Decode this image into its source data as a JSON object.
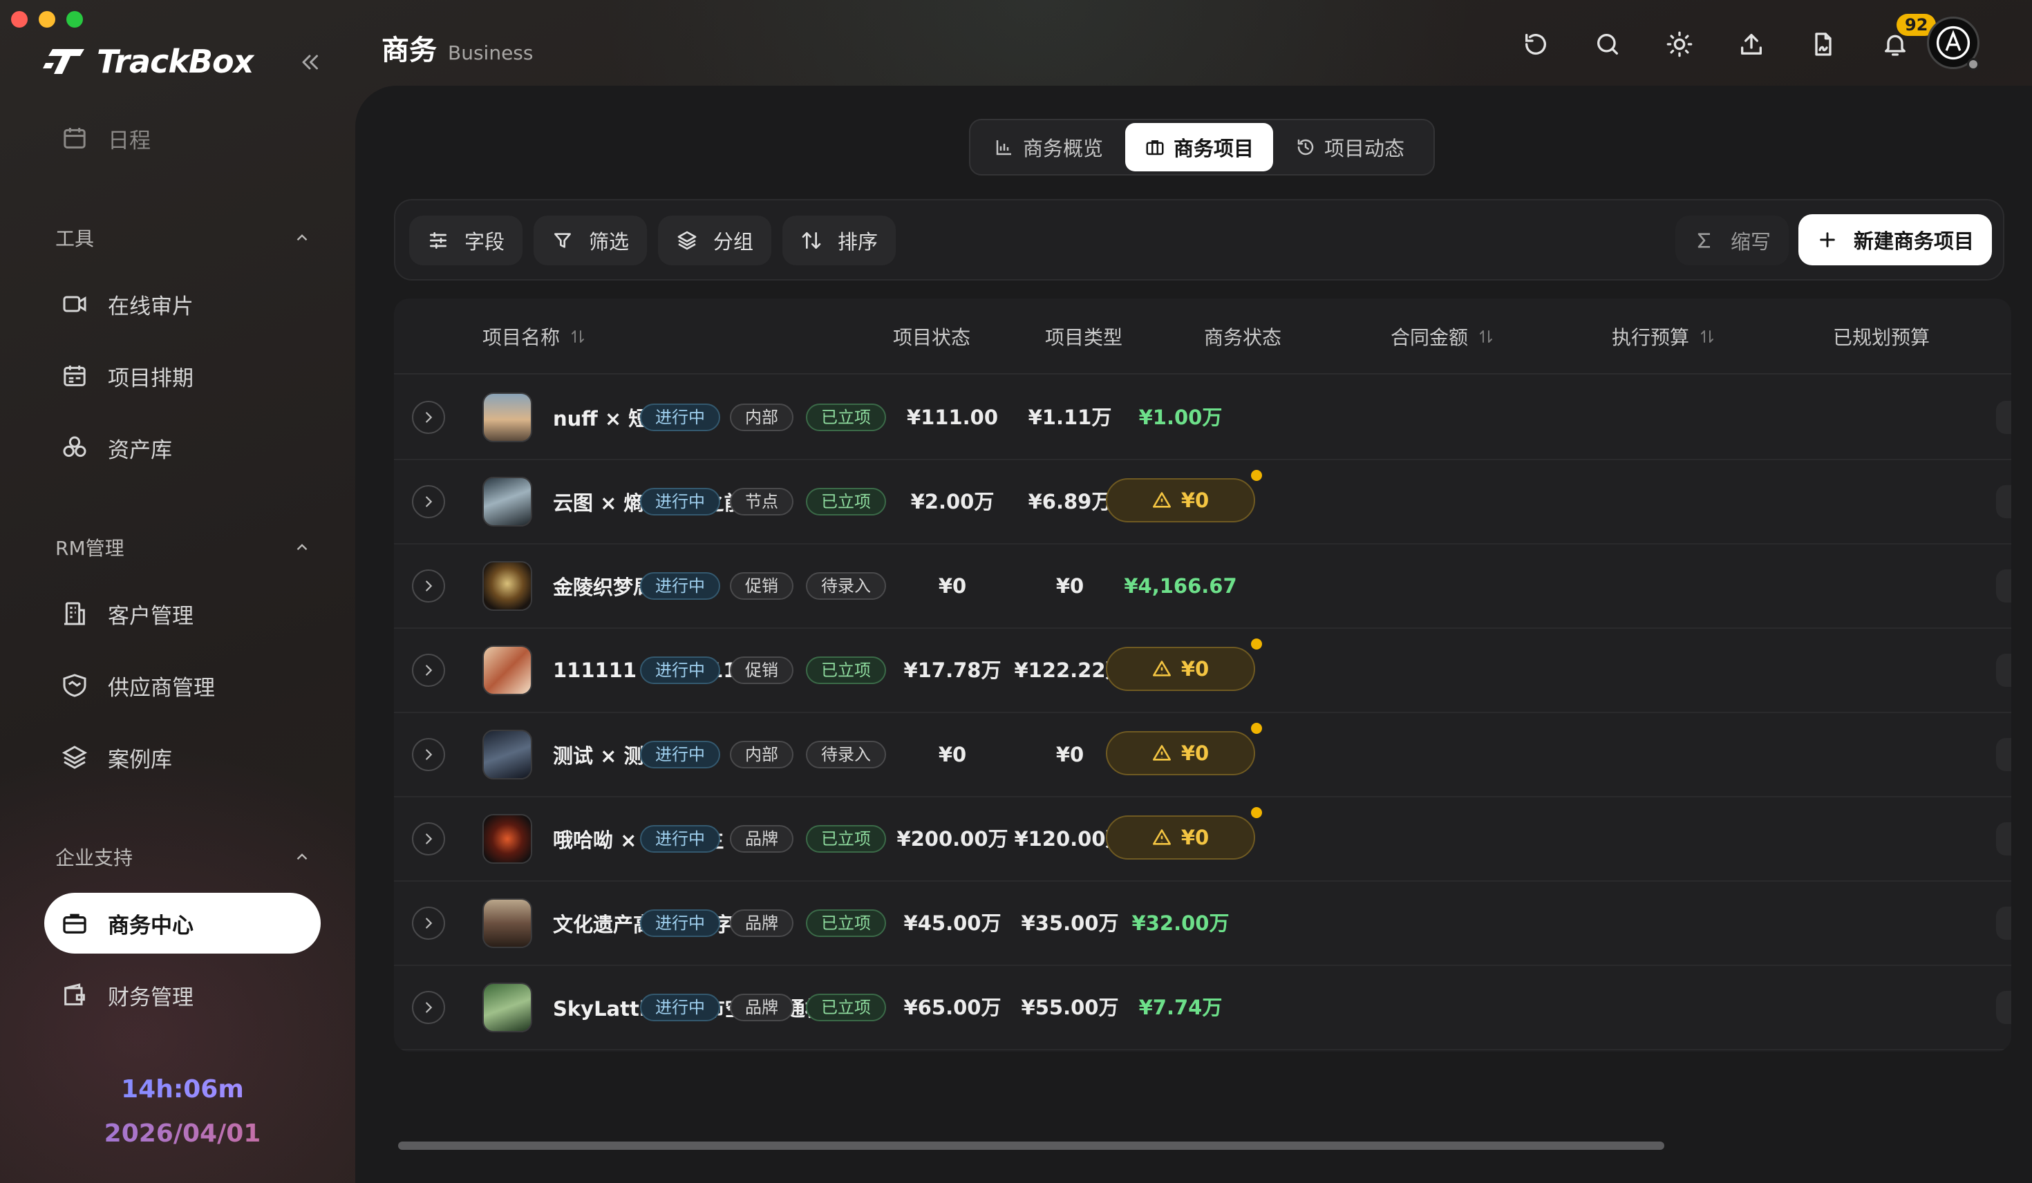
{
  "app": {
    "name": "TrackBox"
  },
  "sidebar": {
    "top_item": {
      "label": "日程",
      "icon": "calendar-icon"
    },
    "sections": [
      {
        "title": "工具",
        "items": [
          {
            "label": "在线审片",
            "icon": "video-icon"
          },
          {
            "label": "项目排期",
            "icon": "schedule-icon"
          },
          {
            "label": "资产库",
            "icon": "assets-icon"
          }
        ]
      },
      {
        "title": "RM管理",
        "items": [
          {
            "label": "客户管理",
            "icon": "building-icon"
          },
          {
            "label": "供应商管理",
            "icon": "handshake-icon"
          },
          {
            "label": "案例库",
            "icon": "layers-icon"
          }
        ]
      },
      {
        "title": "企业支持",
        "items": [
          {
            "label": "商务中心",
            "icon": "briefcase-icon",
            "active": true
          },
          {
            "label": "财务管理",
            "icon": "wallet-icon"
          }
        ]
      }
    ],
    "clock": {
      "time": "14h:06m",
      "date": "2026/04/01"
    }
  },
  "header": {
    "title": "商务",
    "subtitle": "Business",
    "notification_count": "92",
    "icons": [
      "refresh-icon",
      "search-icon",
      "sun-icon",
      "upload-icon",
      "document-sign-icon",
      "bell-icon"
    ]
  },
  "tabs": [
    {
      "label": "商务概览",
      "icon": "bar-chart-icon"
    },
    {
      "label": "商务项目",
      "icon": "briefcase-icon",
      "active": true
    },
    {
      "label": "项目动态",
      "icon": "history-icon"
    }
  ],
  "toolbar": {
    "fields": "字段",
    "filter": "筛选",
    "group": "分组",
    "sort": "排序",
    "abbrev": "缩写",
    "new_project": "新建商务项目"
  },
  "table": {
    "columns": [
      "项目名称",
      "项目状态",
      "项目类型",
      "商务状态",
      "合同金额",
      "执行预算",
      "已规划预算"
    ],
    "rows": [
      {
        "name": "nuff × 短片",
        "status": "进行中",
        "type": "内部",
        "biz_status": "已立项",
        "contract": "¥111.00",
        "budget": "¥1.11万",
        "planned": "¥1.00万",
        "planned_warn": false
      },
      {
        "name": "云图 × 熵增黎明之前",
        "status": "进行中",
        "type": "节点",
        "biz_status": "已立项",
        "contract": "¥2.00万",
        "budget": "¥6.89万",
        "planned": "¥0",
        "planned_warn": true
      },
      {
        "name": "金陵织梦局",
        "status": "进行中",
        "type": "促销",
        "biz_status": "待录入",
        "contract": "¥0",
        "budget": "¥0",
        "planned": "¥4,166.67",
        "planned_warn": false
      },
      {
        "name": "111111 × 111111",
        "status": "进行中",
        "type": "促销",
        "biz_status": "已立项",
        "contract": "¥17.78万",
        "budget": "¥122.22万",
        "planned": "¥0",
        "planned_warn": true
      },
      {
        "name": "测试 × 测试",
        "status": "进行中",
        "type": "内部",
        "biz_status": "待录入",
        "contract": "¥0",
        "budget": "¥0",
        "planned": "¥0",
        "planned_warn": true
      },
      {
        "name": "哦哈呦 × 浴火重生",
        "status": "进行中",
        "type": "品牌",
        "biz_status": "已立项",
        "contract": "¥200.00万",
        "budget": "¥120.00万",
        "planned": "¥0",
        "planned_warn": true
      },
      {
        "name": "文化遗产高精度数字化",
        "status": "进行中",
        "type": "品牌",
        "biz_status": "已立项",
        "contract": "¥45.00万",
        "budget": "¥35.00万",
        "planned": "¥32.00万",
        "planned_warn": false
      },
      {
        "name": "SkyLattice”城市空中交通枢纽",
        "status": "进行中",
        "type": "品牌",
        "biz_status": "已立项",
        "contract": "¥65.00万",
        "budget": "¥55.00万",
        "planned": "¥7.74万",
        "planned_warn": false
      }
    ]
  },
  "colors": {
    "accent_green": "#6de08a",
    "warning": "#f4c542",
    "status_blue": "#9fd0ef"
  }
}
